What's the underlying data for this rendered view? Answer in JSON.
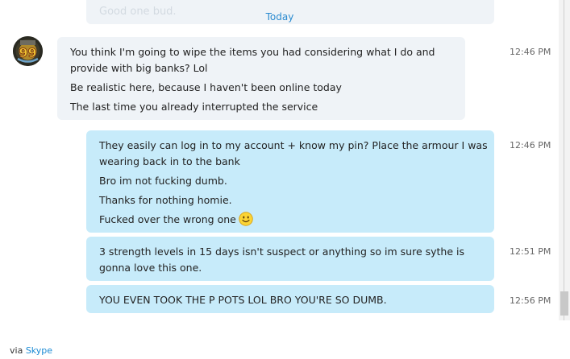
{
  "window": {
    "title": ""
  },
  "previous_message": {
    "text": "Good one bud."
  },
  "day_divider": {
    "label": "Today"
  },
  "incoming": {
    "avatar_text": "99",
    "lines": [
      "You think I'm going to wipe the items you had considering what I do and",
      "provide with big banks? Lol",
      "Be realistic here, because I haven't been online today",
      "The last time you already interrupted the service"
    ],
    "time": "12:46 PM"
  },
  "outgoing": [
    {
      "lines": [
        "They easily can log in to my account + know my pin? Place the armour I was",
        "wearing back in to the bank",
        "Bro im not fucking dumb.",
        "Thanks for nothing homie.",
        "Fucked over the wrong one"
      ],
      "emoji": "smiley-emoji",
      "time": "12:46 PM"
    },
    {
      "lines": [
        "3 strength levels in 15 days isn't suspect or anything so im sure sythe is",
        "gonna love this one."
      ],
      "time": "12:51 PM"
    },
    {
      "lines": [
        "YOU EVEN TOOK THE P POTS LOL BRO YOU'RE SO DUMB."
      ],
      "time": "12:56 PM"
    }
  ],
  "footer": {
    "prefix": "via",
    "link": "Skype"
  },
  "colors": {
    "incoming_bubble": "#eff3f7",
    "outgoing_bubble": "#c7ebfa",
    "accent": "#2b8bd0",
    "timestamp": "#666666"
  }
}
